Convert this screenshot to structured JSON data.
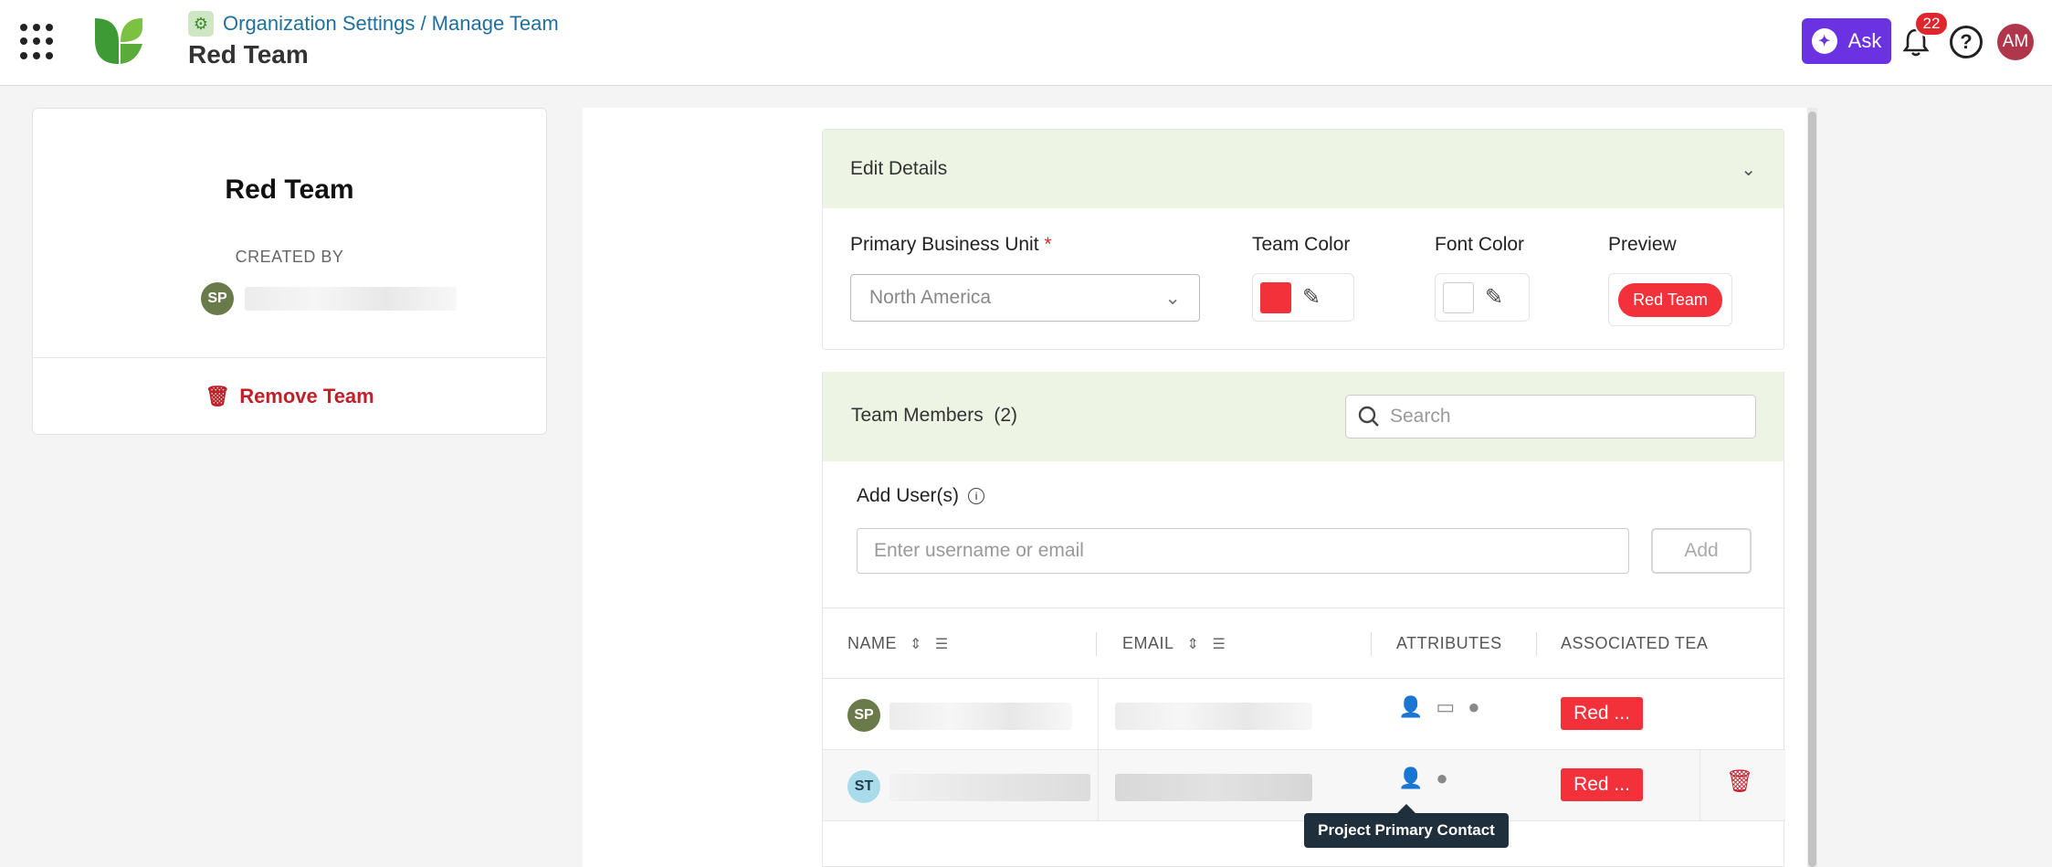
{
  "header": {
    "breadcrumb": "Organization Settings / Manage Team",
    "title": "Red Team",
    "ask_label": "Ask",
    "notification_count": "22",
    "user_initials": "AM"
  },
  "team_card": {
    "name": "Red Team",
    "created_by_label": "CREATED BY",
    "creator_initials": "SP",
    "remove_label": "Remove Team"
  },
  "edit_details": {
    "title": "Edit Details",
    "primary_bu_label": "Primary Business Unit",
    "required_mark": "*",
    "primary_bu_value": "North America",
    "team_color_label": "Team Color",
    "team_color": "#f2313b",
    "font_color_label": "Font Color",
    "font_color": "#ffffff",
    "preview_label": "Preview",
    "preview_text": "Red Team"
  },
  "members": {
    "title": "Team Members",
    "count": "(2)",
    "search_placeholder": "Search",
    "add_label": "Add User(s)",
    "user_input_placeholder": "Enter username or email",
    "add_button": "Add",
    "columns": {
      "name": "NAME",
      "email": "EMAIL",
      "attributes": "ATTRIBUTES",
      "associated": "ASSOCIATED TEA"
    },
    "rows": [
      {
        "initials": "SP",
        "team_tag": "Red ..."
      },
      {
        "initials": "ST",
        "team_tag": "Red ..."
      }
    ],
    "tooltip": "Project Primary Contact"
  }
}
